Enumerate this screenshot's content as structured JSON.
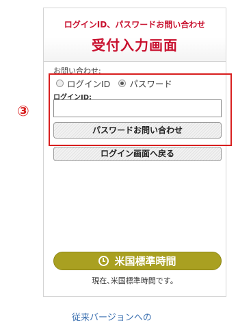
{
  "header": {
    "subtitle": "ログインID、パスワードお問い合わせ",
    "title": "受付入力画面"
  },
  "form": {
    "inquiry_label": "お問い合わせ:",
    "radio_options": [
      {
        "label": "ログインID",
        "checked": false
      },
      {
        "label": "パスワード",
        "checked": true
      }
    ],
    "login_id_label": "ログインID:",
    "login_id_value": "",
    "submit_label": "パスワードお問い合わせ",
    "back_label": "ログイン画面へ戻る"
  },
  "annotation": {
    "step_marker": "③",
    "highlight_color": "#d81e1e"
  },
  "time_section": {
    "button_label": "米国標準時間",
    "note": "現在､米国標準時間です。",
    "button_color": "#a9a021"
  },
  "footer": {
    "link_text": "従来バージョンへの"
  },
  "colors": {
    "accent_red": "#c8102e"
  }
}
